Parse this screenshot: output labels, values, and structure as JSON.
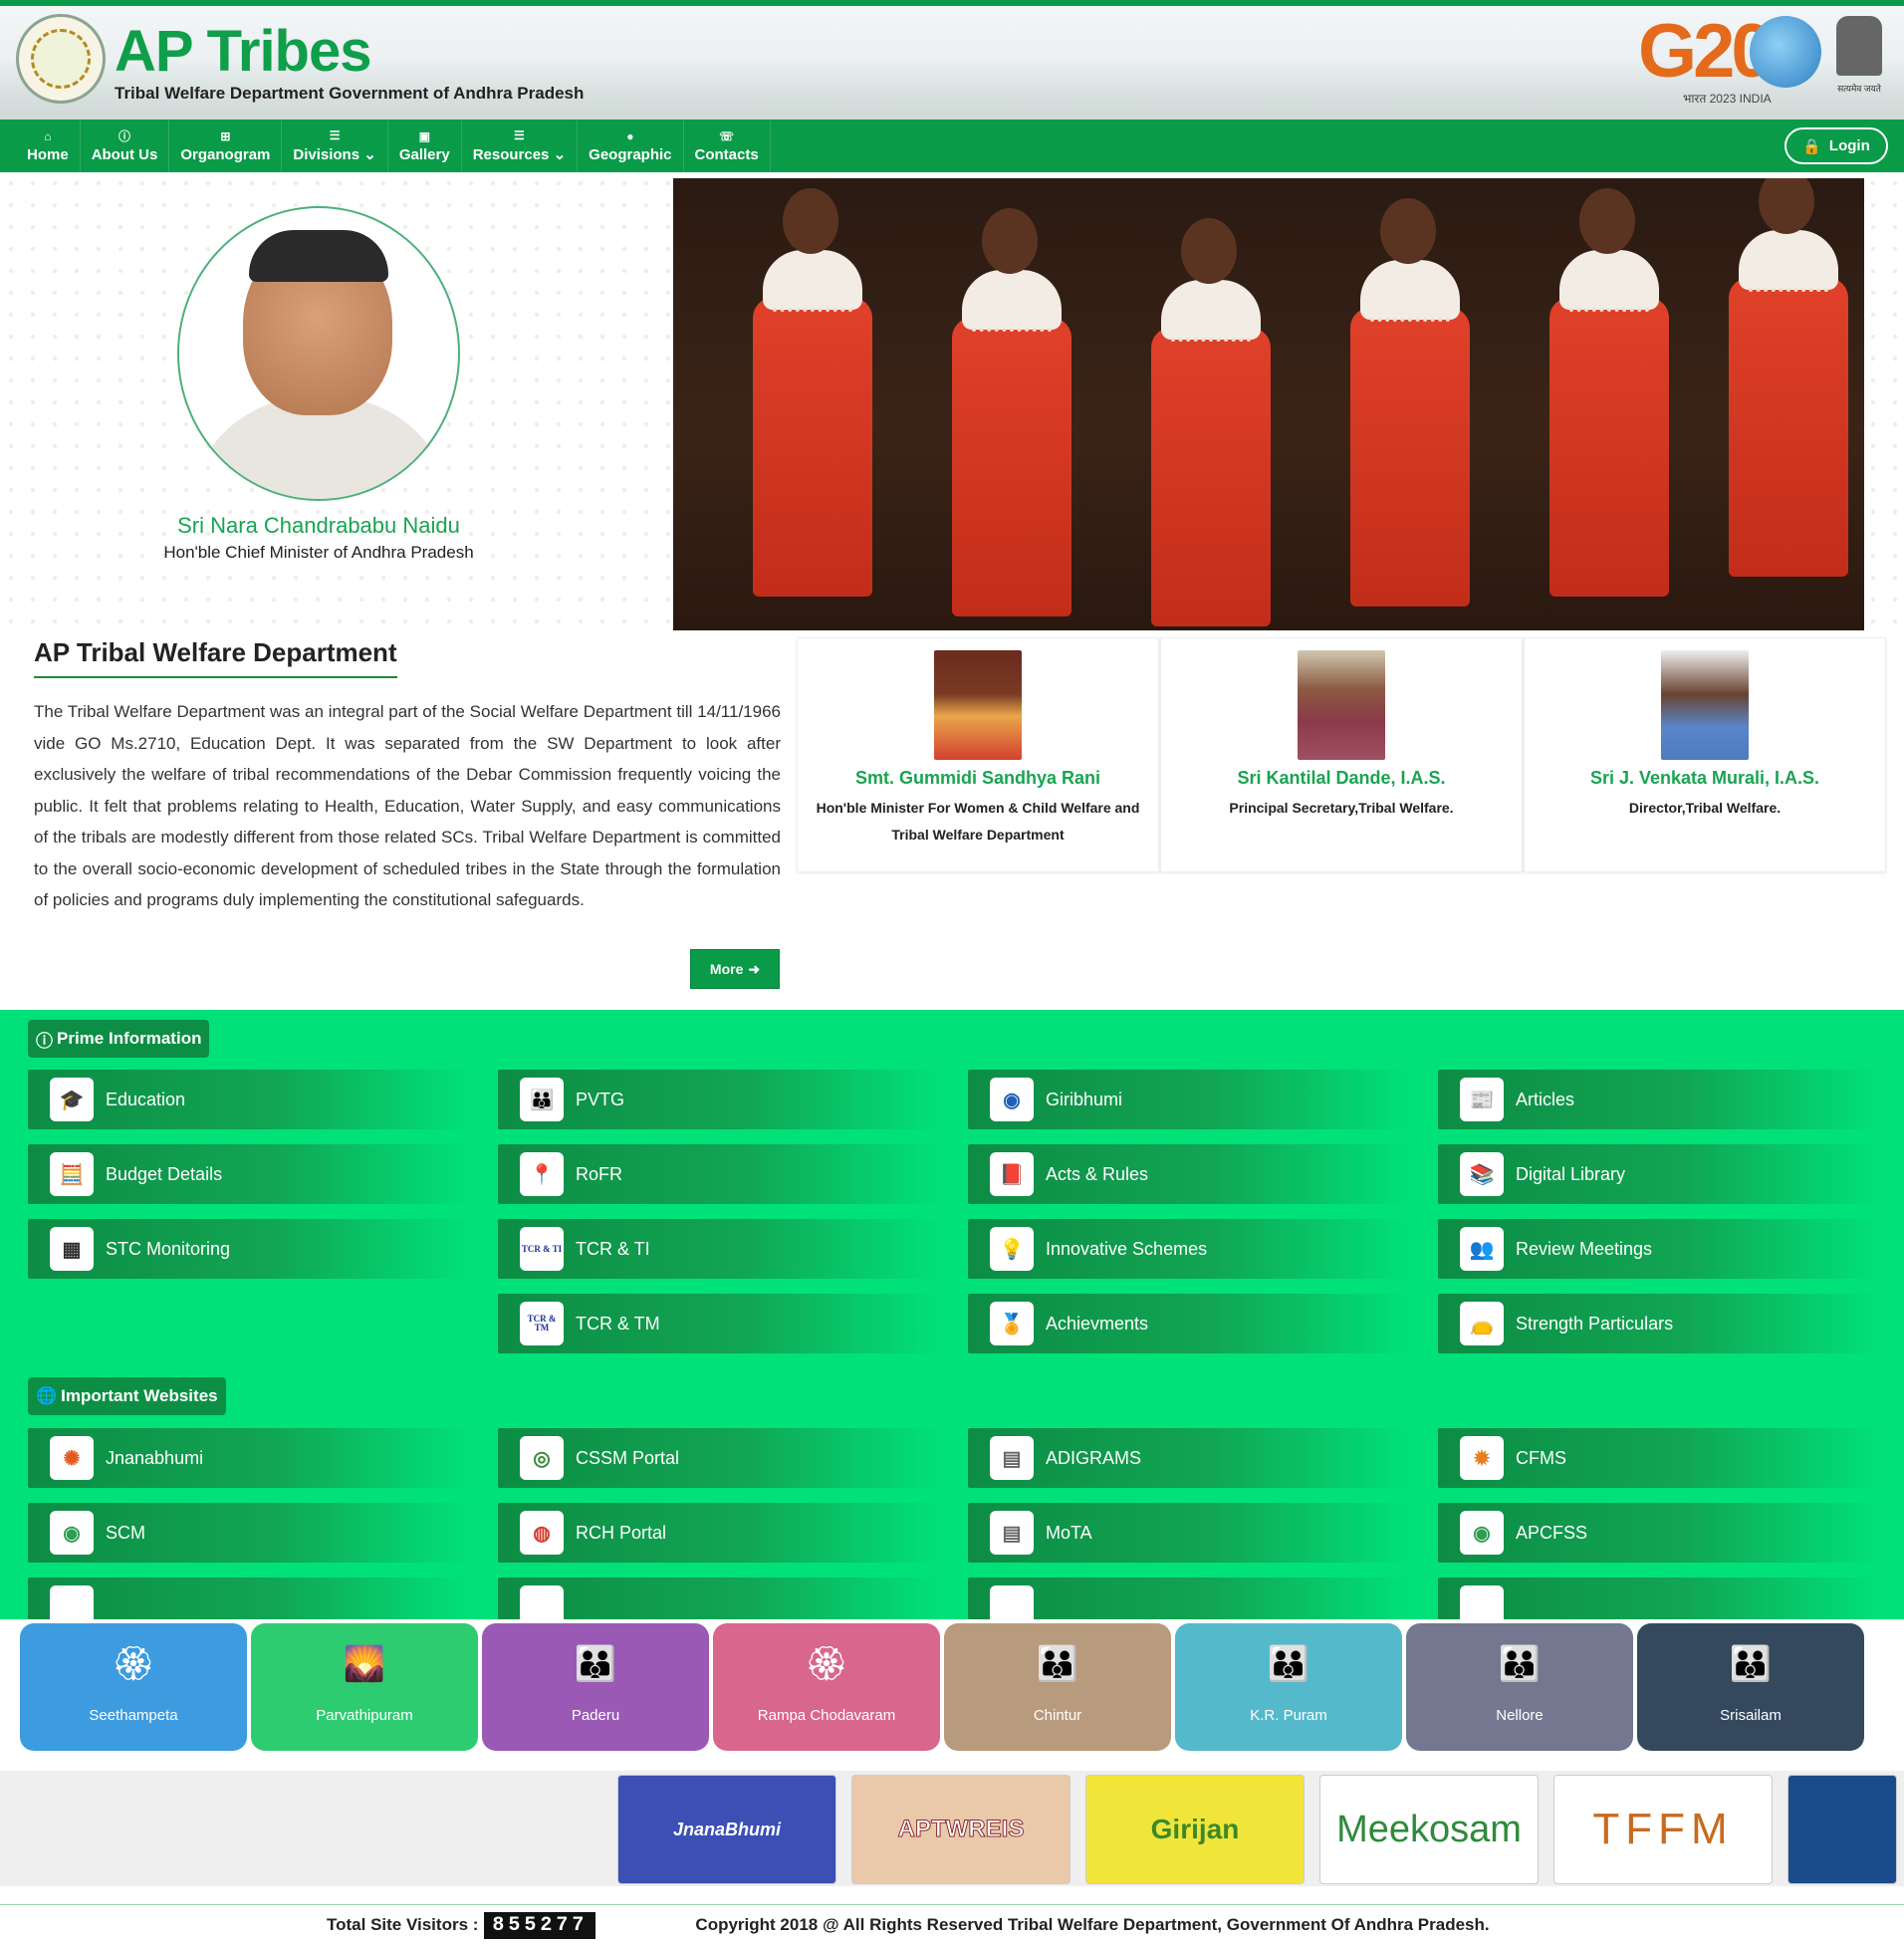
{
  "header": {
    "brand_title": "AP Tribes",
    "brand_subtitle": "Tribal Welfare Department Government of Andhra Pradesh",
    "g20_text": "G20",
    "g20_sub": "भारत 2023 INDIA",
    "emblem_motto": "सत्यमेव जयते"
  },
  "nav": {
    "items": [
      {
        "label": "Home",
        "icon": "home-icon"
      },
      {
        "label": "About Us",
        "icon": "info-icon"
      },
      {
        "label": "Organogram",
        "icon": "sitemap-icon"
      },
      {
        "label": "Divisions",
        "icon": "list-icon",
        "dropdown": true
      },
      {
        "label": "Gallery",
        "icon": "image-icon"
      },
      {
        "label": "Resources",
        "icon": "list-icon",
        "dropdown": true
      },
      {
        "label": "Geographic",
        "icon": "map-marker-icon"
      },
      {
        "label": "Contacts",
        "icon": "phone-icon"
      }
    ],
    "login_label": "Login"
  },
  "hero": {
    "cm_name": "Sri Nara Chandrababu Naidu",
    "cm_title": "Hon'ble Chief Minister of Andhra Pradesh"
  },
  "about": {
    "heading": "AP Tribal Welfare Department",
    "body": "The Tribal Welfare Department was an integral part of the Social Welfare Department till 14/11/1966 vide GO Ms.2710, Education Dept. It was separated from the SW Department to look after exclusively the welfare of tribal recommendations of the Debar Commission frequently voicing the public. It felt that problems relating to Health, Education, Water Supply, and easy communications of the tribals are modestly different from those related SCs. Tribal Welfare Department is committed to the overall socio-economic development of scheduled tribes in the State through the formulation of policies and programs duly implementing the constitutional safeguards.",
    "more_label": "More"
  },
  "officials": [
    {
      "name": "Smt. Gummidi Sandhya Rani",
      "role": "Hon'ble Minister For Women & Child Welfare and Tribal Welfare Department"
    },
    {
      "name": "Sri Kantilal Dande, I.A.S.",
      "role": "Principal Secretary,Tribal Welfare."
    },
    {
      "name": "Sri J. Venkata Murali, I.A.S.",
      "role": "Director,Tribal Welfare."
    }
  ],
  "prime_information": {
    "label": "Prime Information",
    "items": [
      "Education",
      "PVTG",
      "Giribhumi",
      "Articles",
      "Budget Details",
      "RoFR",
      "Acts & Rules",
      "Digital Library",
      "STC Monitoring",
      "TCR & TI",
      "Innovative Schemes",
      "Review Meetings",
      "TCR & TM",
      "Achievments",
      "Strength Particulars"
    ],
    "icon_text": {
      "tcr_ti": "TCR & TI",
      "tcr_tm": "TCR & TM"
    }
  },
  "important_websites": {
    "label": "Important Websites",
    "items": [
      "Jnanabhumi",
      "CSSM Portal",
      "ADIGRAMS",
      "CFMS",
      "SCM",
      "RCH Portal",
      "MoTA",
      "APCFSS"
    ]
  },
  "districts": [
    "Seethampeta",
    "Parvathipuram",
    "Paderu",
    "Rampa Chodavaram",
    "Chintur",
    "K.R. Puram",
    "Nellore",
    "Srisailam"
  ],
  "partners": [
    "JnanaBhumi",
    "APTWREIS",
    "Girijan",
    "Meekosam",
    "TFFM"
  ],
  "footer": {
    "visitors_label": "Total Site Visitors :",
    "visitors_count": "855277",
    "copyright": "Copyright 2018 @ All Rights Reserved Tribal Welfare Department, Government Of Andhra Pradesh."
  },
  "colors": {
    "primary_green": "#0a9b48",
    "prime_bg": "#00e17a",
    "district_colors": [
      "#3d9be0",
      "#2ecc71",
      "#9b59b6",
      "#d9668c",
      "#b89a7c",
      "#55b9cc",
      "#737890",
      "#34495e"
    ]
  }
}
